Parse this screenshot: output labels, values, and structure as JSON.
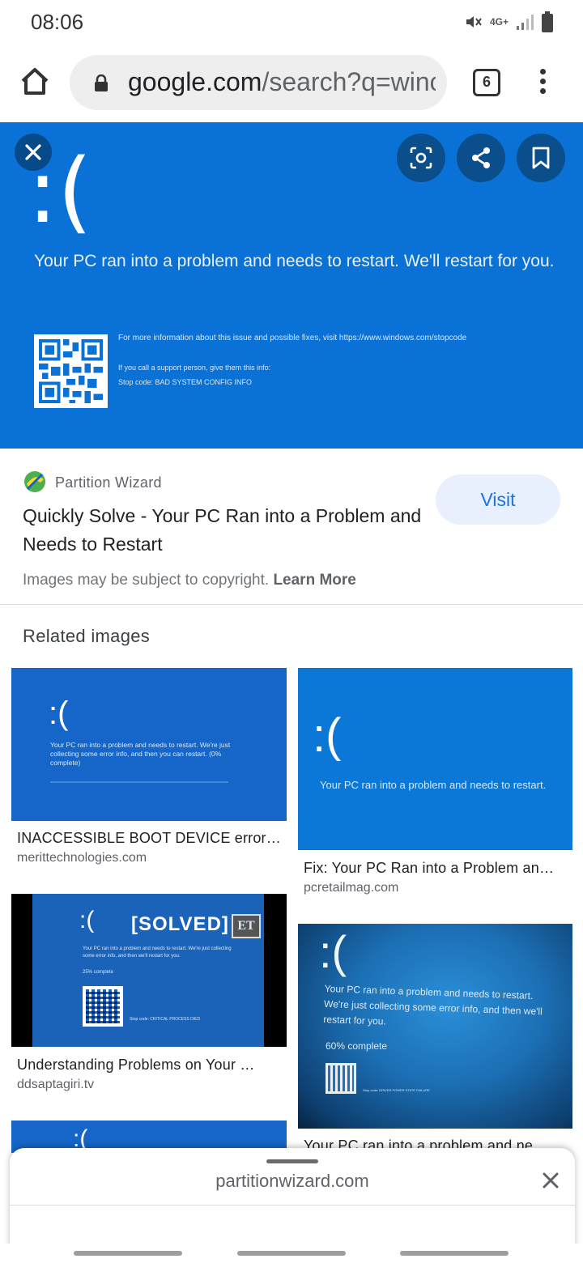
{
  "status_bar": {
    "time": "08:06",
    "network": "4G+"
  },
  "browser": {
    "url_domain": "google.com",
    "url_path": "/search?q=winc",
    "tab_count": "6"
  },
  "hero": {
    "face": ":(",
    "message": "Your PC ran into a problem and needs to restart. We'll restart for you.",
    "info_line": "For more information about this issue and possible fixes, visit https://www.windows.com/stopcode",
    "support_line": "If you call a support person, give them this info:",
    "stop_code": "Stop code: BAD SYSTEM CONFIG INFO"
  },
  "result": {
    "source_name": "Partition Wizard",
    "visit_label": "Visit",
    "title": "Quickly Solve - Your PC Ran into a Problem and Needs to Restart",
    "copyright_text": "Images may be subject to copyright.",
    "learn_more": "Learn More"
  },
  "related": {
    "heading": "Related images",
    "items": [
      {
        "face": ":(",
        "image_text": "Your PC ran into a problem and needs to restart. We're just collecting some error info, and then you can restart. (0% complete)",
        "caption": "INACCESSIBLE BOOT DEVICE error…",
        "domain": "merittechnologies.com"
      },
      {
        "face": ":(",
        "image_text": "Your PC ran into a problem and needs to restart.",
        "caption": "Fix: Your PC Ran into a Problem an…",
        "domain": "pcretailmag.com"
      },
      {
        "face": ":(",
        "badge": "[SOLVED]",
        "logo": "ET",
        "image_text": "Your PC ran into a problem and needs to restart. We're just collecting some error info, and then we'll restart for you.",
        "progress": "25% complete",
        "stop_code": "Stop code: CRITICAL PROCESS DIED",
        "caption": "Understanding Problems on Your …",
        "domain": "ddsaptagiri.tv"
      },
      {
        "face": ":(",
        "image_text": "Your PC ran into a problem and needs to restart. We're just collecting some error info, and then we'll restart for you.",
        "progress": "60% complete",
        "stop_code": "Stop code: DRIVER POWER STATE FAILURE",
        "caption": "Your PC ran into a problem and ne…"
      },
      {
        "face": ":("
      }
    ]
  },
  "bottom_sheet": {
    "domain": "partitionwizard.com"
  },
  "colors": {
    "bsod_blue": "#0a72d6",
    "link_blue": "#1a73e8",
    "visit_bg": "#e8f0fe"
  }
}
